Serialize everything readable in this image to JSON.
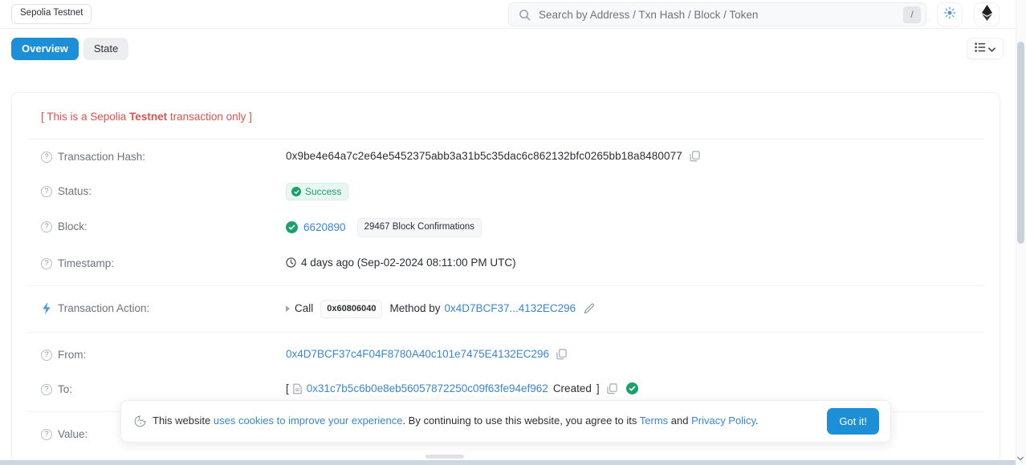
{
  "header": {
    "network_chip": "Sepolia Testnet",
    "search_placeholder": "Search by Address / Txn Hash / Block / Token",
    "search_value": "",
    "slash_key": "/",
    "theme_icon": "sun-icon",
    "brand_icon": "ethereum-logo-icon"
  },
  "tabs": {
    "overview": "Overview",
    "state": "State",
    "more_icon": "list-chevron-icon"
  },
  "card": {
    "testnet_note_prefix": "[ This is a Sepolia ",
    "testnet_note_bold": "Testnet",
    "testnet_note_suffix": " transaction only ]",
    "rows": {
      "transaction_hash": {
        "label": "Transaction Hash:",
        "value": "0x9be4e64a7c2e64e5452375abb3a31b5c35dac6c862132bfc0265bb18a8480077",
        "copy_icon": "copy-icon"
      },
      "status": {
        "label": "Status:",
        "badge": "Success",
        "badge_color": "#1aa06d",
        "badge_bg": "#e8f7f0"
      },
      "block": {
        "label": "Block:",
        "number": "6620890",
        "confirmations": "29467 Block Confirmations",
        "check_icon": "check-circle-icon"
      },
      "timestamp": {
        "label": "Timestamp:",
        "value": "4 days ago (Sep-02-2024 08:11:00 PM UTC)",
        "clock_icon": "clock-icon"
      },
      "transaction_action": {
        "label": "Transaction Action:",
        "bolt_icon": "lightning-bolt-icon",
        "caret_icon": "caret-right-icon",
        "call_text": "Call",
        "method_pill": "0x60806040",
        "method_by_text": "Method by",
        "method_by_address": "0x4D7BCF37...4132EC296",
        "edit_icon": "pencil-icon"
      },
      "from": {
        "label": "From:",
        "address": "0x4D7BCF37c4F04F8780A40c101e7475E4132EC296",
        "copy_icon": "copy-icon"
      },
      "to": {
        "label": "To:",
        "open_bracket": "[",
        "contract_icon": "contract-document-icon",
        "address": "0x31c7b5c6b0e8eb56057872250c09f63fe94ef962",
        "created_text": "Created",
        "close_bracket": "]",
        "copy_icon": "copy-icon",
        "verified_icon": "verified-check-icon"
      },
      "value": {
        "label": "Value:"
      }
    }
  },
  "cookie_banner": {
    "cookie_icon": "cookie-icon",
    "text_1": "This website ",
    "link_1": "uses cookies to improve your experience",
    "text_2": ". By continuing to use this website, you agree to its ",
    "link_2": "Terms",
    "text_3": " and ",
    "link_3": "Privacy Policy",
    "text_4": ".",
    "button": "Got it!"
  },
  "colors": {
    "accent_blue": "#1c8fd6",
    "link_blue": "#3a87c9",
    "success_green": "#1aa06d",
    "testnet_red": "#d9534f"
  }
}
